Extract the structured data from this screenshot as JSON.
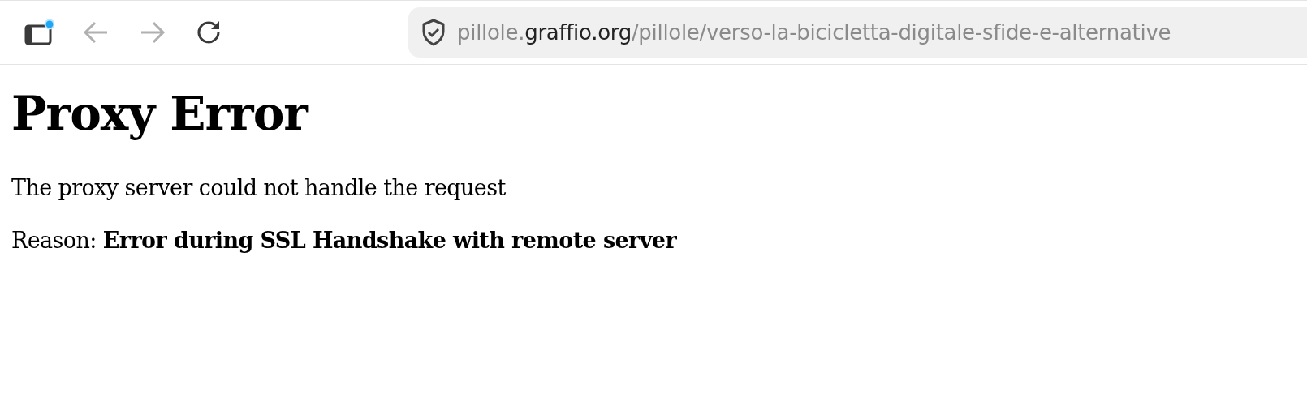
{
  "toolbar": {
    "sidebar_button": {
      "notification": true
    },
    "back_button": {
      "disabled": true
    },
    "forward_button": {
      "disabled": true
    },
    "address": {
      "parts": [
        {
          "text": "pillole.",
          "kind": "subdomain"
        },
        {
          "text": "graffio.org",
          "kind": "domain"
        },
        {
          "text": "/pillole/verso-la-bicicletta-digitale-sfide-e-alternative",
          "kind": "path"
        }
      ]
    }
  },
  "page": {
    "title": "Proxy Error",
    "message": "The proxy server could not handle the request",
    "reason": "Reason: **Error during SSL Handshake with remote server**"
  }
}
